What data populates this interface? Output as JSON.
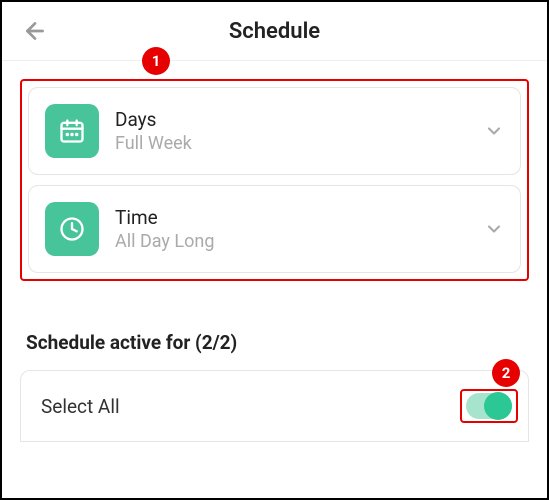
{
  "header": {
    "title": "Schedule"
  },
  "cards": {
    "days": {
      "title": "Days",
      "subtitle": "Full Week"
    },
    "time": {
      "title": "Time",
      "subtitle": "All Day Long"
    }
  },
  "section": {
    "title": "Schedule active for (2/2)",
    "select_all_label": "Select All",
    "toggle_on": true
  },
  "callouts": {
    "one": "1",
    "two": "2"
  },
  "colors": {
    "accent": "#48c49a",
    "toggle_knob": "#2bc795",
    "callout": "#e60000"
  }
}
